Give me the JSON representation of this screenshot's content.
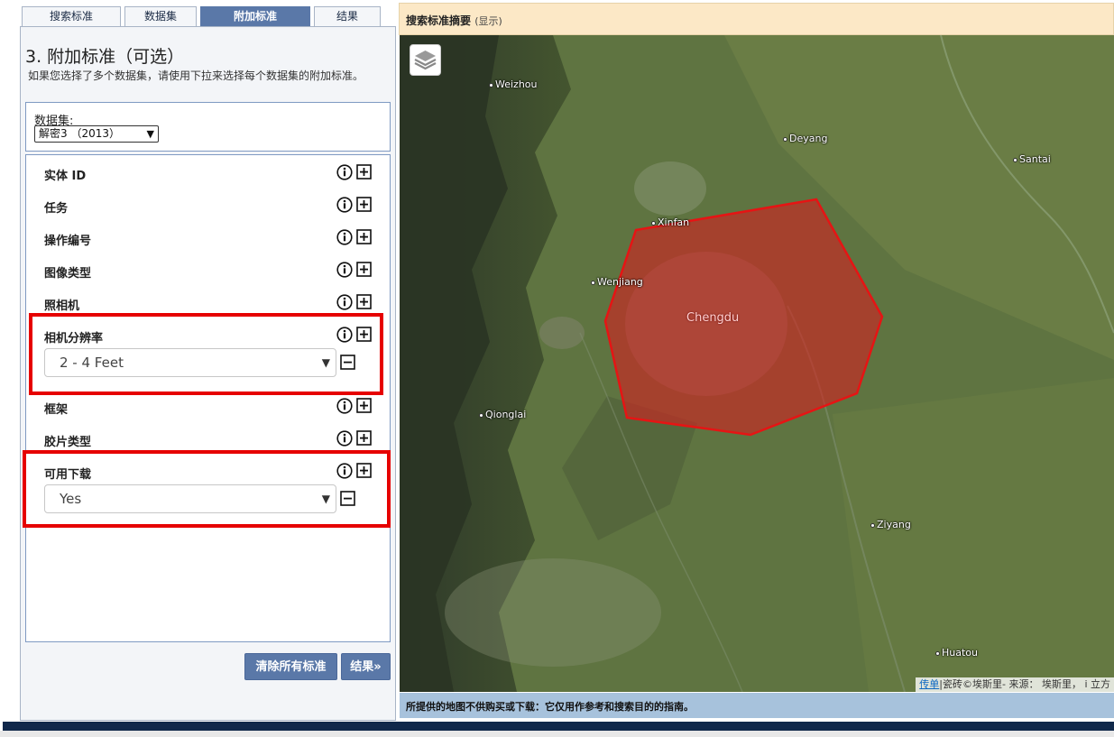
{
  "tabs": [
    {
      "label": "搜索标准",
      "active": false
    },
    {
      "label": "数据集",
      "active": false
    },
    {
      "label": "附加标准",
      "active": true
    },
    {
      "label": "结果",
      "active": false
    }
  ],
  "panel": {
    "title": "3. 附加标准（可选）",
    "description": "如果您选择了多个数据集，请使用下拉来选择每个数据集的附加标准。",
    "dataset_label": "数据集:",
    "dataset_value": "解密3 （2013）"
  },
  "criteria": [
    {
      "label": "实体 ID"
    },
    {
      "label": "任务"
    },
    {
      "label": "操作编号"
    },
    {
      "label": "图像类型"
    },
    {
      "label": "照相机"
    },
    {
      "label": "相机分辨率",
      "selected": "2 - 4 Feet"
    },
    {
      "label": "框架"
    },
    {
      "label": "胶片类型"
    },
    {
      "label": "可用下载",
      "selected": "Yes"
    }
  ],
  "buttons": {
    "clear": "清除所有标准",
    "results": "结果»"
  },
  "map": {
    "header_title": "搜索标准摘要",
    "header_sub": "(显示)",
    "aoi_label": "Chengdu",
    "cities": [
      "Weizhou",
      "Deyang",
      "Santai",
      "Xinfan",
      "Wenjiang",
      "Qionglai",
      "Ziyang",
      "Huatou"
    ],
    "attribution_link": "传单",
    "attribution_text": "|瓷砖©埃斯里- 来源： 埃斯里， i 立方",
    "footer": "所提供的地图不供购买或下载：它仅用作参考和搜索目的的指南。"
  },
  "colors": {
    "accent": "#5a78a8",
    "highlight": "#e60000",
    "header_bg": "#fce8c6",
    "footer_bg": "#a7c2dc",
    "aoi_fill": "#d42020"
  }
}
